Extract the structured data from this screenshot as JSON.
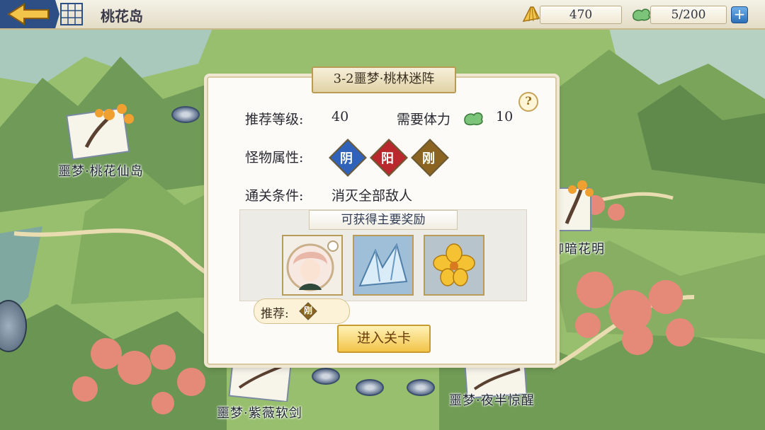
{
  "header": {
    "location_title": "桃花岛",
    "gold_value": "470",
    "stamina_value": "5/200",
    "add_label": "+"
  },
  "map": {
    "nodes": [
      {
        "label": "噩梦·桃花仙岛"
      },
      {
        "label": "柳暗花明"
      },
      {
        "label": "噩梦·紫薇软剑"
      },
      {
        "label": "噩梦·夜半惊醒"
      }
    ]
  },
  "panel": {
    "title": "3-2噩梦·桃林迷阵",
    "help_label": "?",
    "rec_level_label": "推荐等级:",
    "rec_level_value": "40",
    "stamina_label": "需要体力",
    "stamina_value": "10",
    "attr_label": "怪物属性:",
    "attributes": [
      "阴",
      "阳",
      "刚"
    ],
    "clear_label": "通关条件:",
    "clear_value": "消灭全部敌人",
    "rewards_title": "可获得主要奖励",
    "recommend_label": "推荐:",
    "recommend_attr": "刚",
    "enter_button": "进入关卡"
  },
  "colors": {
    "yin": "#2f62b8",
    "yang": "#b8282c",
    "gang": "#8a6420",
    "gold": "#f2c44a"
  },
  "icons": [
    "back-arrow-icon",
    "grid-icon",
    "gold-fan-icon",
    "cloud-icon",
    "plus-icon",
    "help-icon",
    "scroll-icon",
    "stage-marker-icon"
  ]
}
